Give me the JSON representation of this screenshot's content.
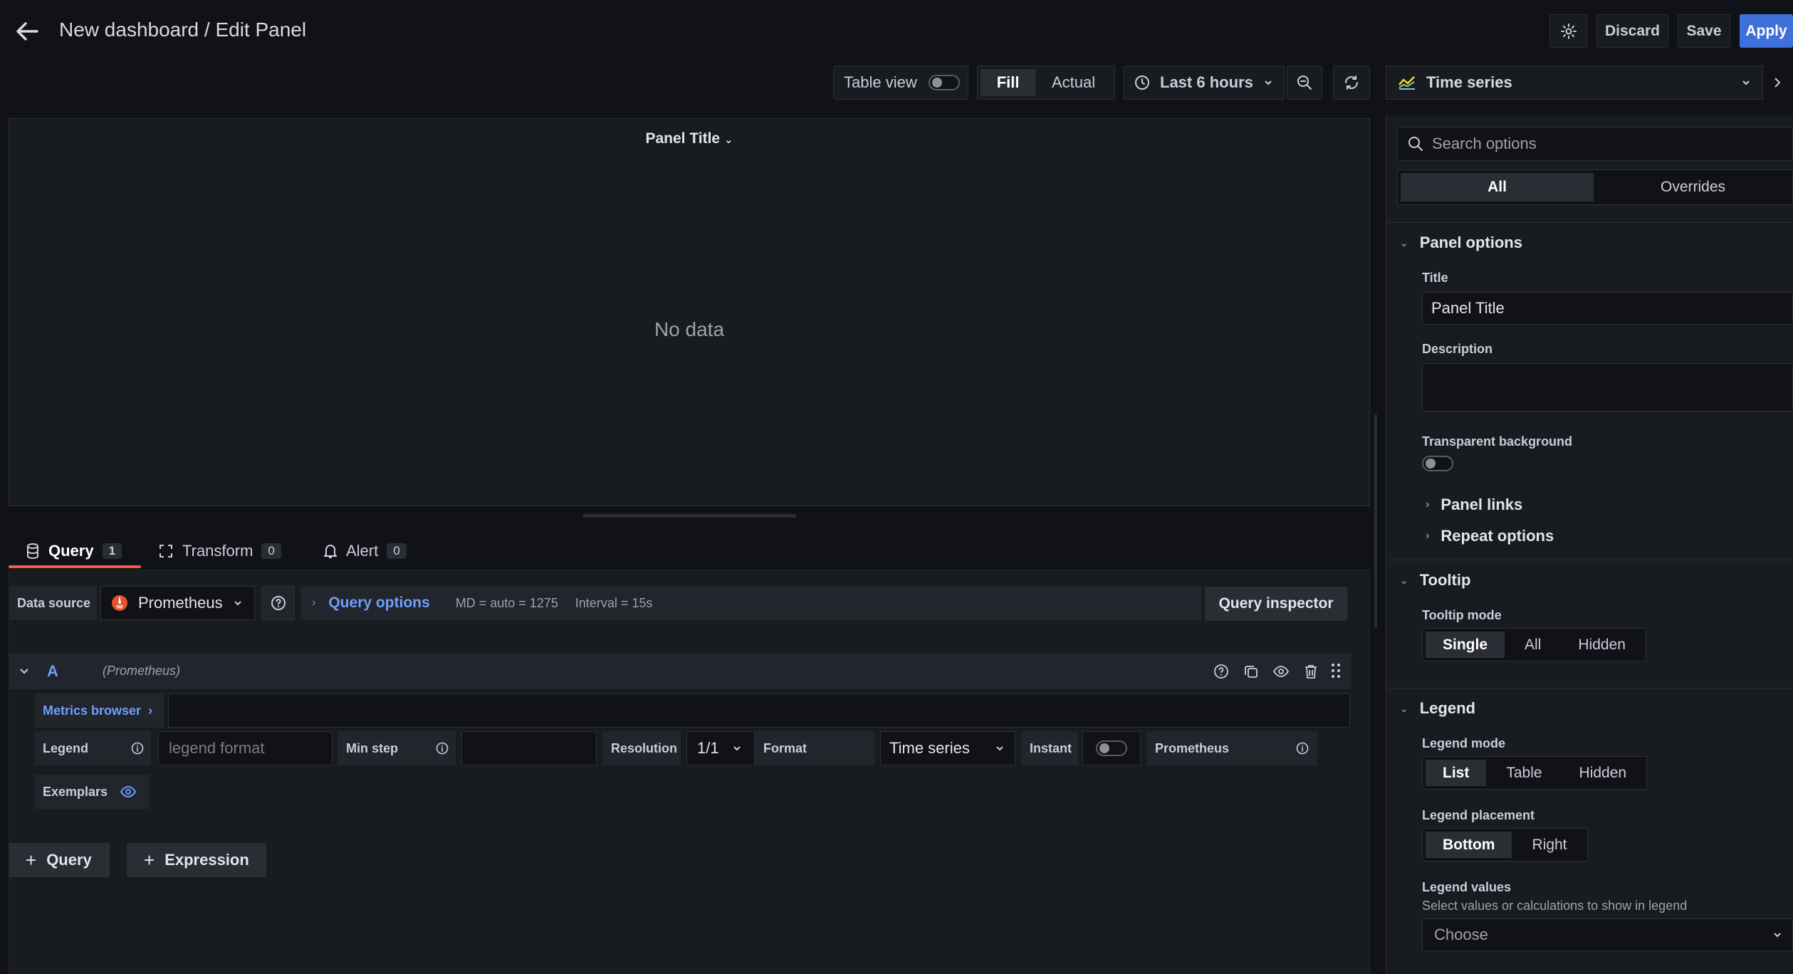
{
  "header": {
    "breadcrumb": "New dashboard / Edit Panel",
    "discard_label": "Discard",
    "save_label": "Save",
    "apply_label": "Apply"
  },
  "toolbar": {
    "table_view_label": "Table view",
    "fill_label": "Fill",
    "actual_label": "Actual",
    "time_range": "Last 6 hours"
  },
  "panel": {
    "title": "Panel Title",
    "empty_text": "No data"
  },
  "tabs": [
    {
      "label": "Query",
      "count": "1"
    },
    {
      "label": "Transform",
      "count": "0"
    },
    {
      "label": "Alert",
      "count": "0"
    }
  ],
  "query_row": {
    "datasource_label": "Data source",
    "datasource_value": "Prometheus",
    "query_options_label": "Query options",
    "md_text": "MD = auto = 1275",
    "interval_text": "Interval = 15s",
    "inspector_label": "Query inspector"
  },
  "query_a": {
    "ref": "A",
    "datasource_hint": "(Prometheus)",
    "metrics_browser_label": "Metrics browser",
    "legend_label": "Legend",
    "legend_placeholder": "legend format",
    "min_step_label": "Min step",
    "resolution_label": "Resolution",
    "resolution_value": "1/1",
    "format_label": "Format",
    "format_value": "Time series",
    "instant_label": "Instant",
    "type_label": "Prometheus",
    "exemplars_label": "Exemplars"
  },
  "add_buttons": {
    "query_label": "Query",
    "expression_label": "Expression"
  },
  "options_pane": {
    "viz_type": "Time series",
    "search_placeholder": "Search options",
    "filter_all": "All",
    "filter_overrides": "Overrides",
    "panel_options_header": "Panel options",
    "title_label": "Title",
    "title_value": "Panel Title",
    "description_label": "Description",
    "transparent_label": "Transparent background",
    "panel_links_label": "Panel links",
    "repeat_options_label": "Repeat options",
    "tooltip_header": "Tooltip",
    "tooltip_mode_label": "Tooltip mode",
    "tooltip_modes": [
      "Single",
      "All",
      "Hidden"
    ],
    "legend_header": "Legend",
    "legend_mode_label": "Legend mode",
    "legend_modes": [
      "List",
      "Table",
      "Hidden"
    ],
    "legend_placement_label": "Legend placement",
    "legend_placements": [
      "Bottom",
      "Right"
    ],
    "legend_values_label": "Legend values",
    "legend_values_desc": "Select values or calculations to show in legend",
    "legend_values_placeholder": "Choose"
  },
  "colors": {
    "background": "#111217",
    "panel": "#181b1f",
    "accent_blue": "#3d71d9",
    "tab_underline": "#f55f3e",
    "link_blue": "#6e9fff"
  }
}
